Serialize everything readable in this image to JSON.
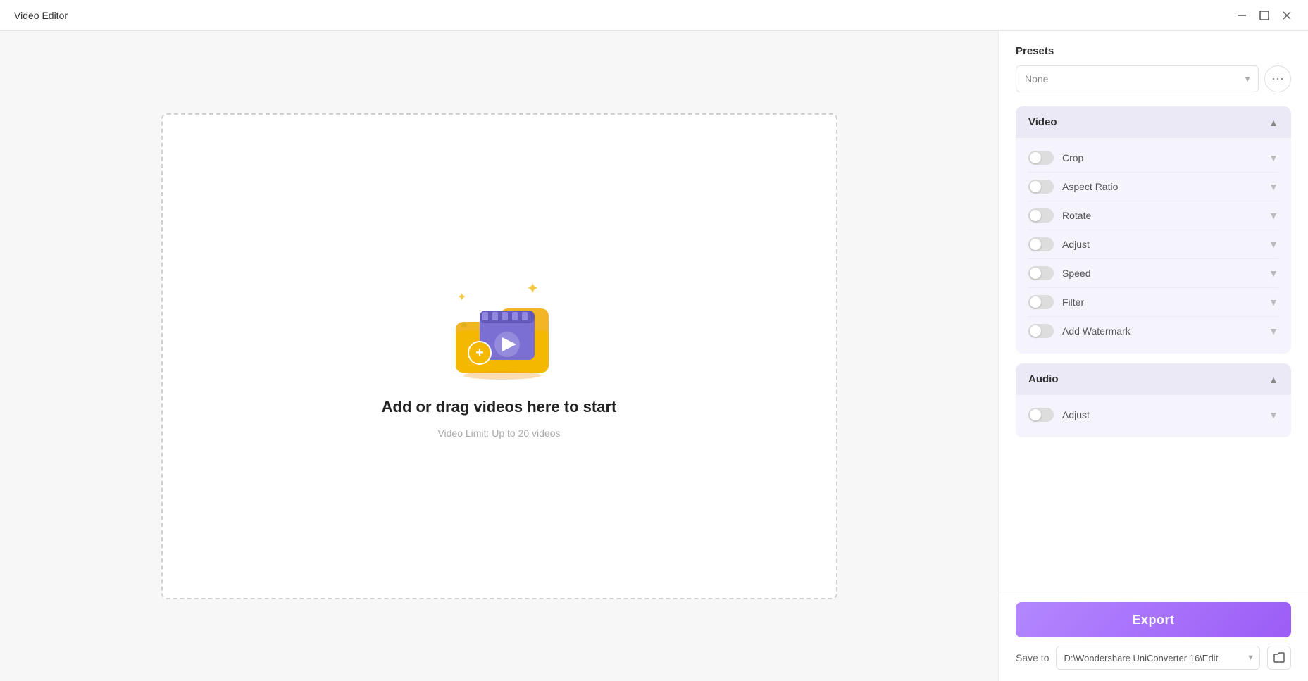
{
  "titleBar": {
    "title": "Video Editor",
    "minimizeBtn": "─",
    "maximizeBtn": "□",
    "closeBtn": "✕"
  },
  "dropZone": {
    "title": "Add or drag videos here to start",
    "subtitle": "Video Limit: Up to 20 videos"
  },
  "rightPanel": {
    "presetsLabel": "Presets",
    "presetsOptions": [
      "None"
    ],
    "presetsSelected": "None",
    "moreBtn": "⋯",
    "videoSection": {
      "label": "Video",
      "items": [
        {
          "label": "Crop",
          "enabled": false
        },
        {
          "label": "Aspect Ratio",
          "enabled": false
        },
        {
          "label": "Rotate",
          "enabled": false
        },
        {
          "label": "Adjust",
          "enabled": false
        },
        {
          "label": "Speed",
          "enabled": false
        },
        {
          "label": "Filter",
          "enabled": false
        },
        {
          "label": "Add Watermark",
          "enabled": false
        }
      ]
    },
    "audioSection": {
      "label": "Audio",
      "items": [
        {
          "label": "Adjust",
          "enabled": false
        }
      ]
    },
    "exportBtn": "Export",
    "saveToLabel": "Save to",
    "savePath": "D:\\Wondershare UniConverter 16\\Edit"
  }
}
